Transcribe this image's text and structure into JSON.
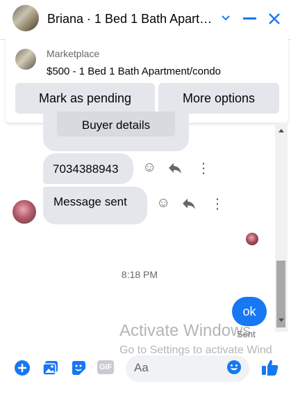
{
  "header": {
    "title": "Briana · 1 Bed 1 Bath Apart…",
    "icons": [
      "chevron-down-icon",
      "minimize-icon",
      "close-icon"
    ]
  },
  "marketplace": {
    "label": "Marketplace",
    "listing": "$500 - 1 Bed 1 Bath Apartment/condo",
    "buttons": {
      "mark_pending": "Mark as pending",
      "more_options": "More options"
    }
  },
  "chat": {
    "buyer_details": "Buyer details",
    "messages": [
      {
        "text": "7034388943"
      },
      {
        "text": "Message sent"
      }
    ],
    "timestamp": "8:18 PM",
    "outgoing": "ok",
    "status": "Sent"
  },
  "watermark": {
    "line1": "Activate Windows",
    "line2": "Go to Settings to activate Wind"
  },
  "composer": {
    "placeholder": "Aa",
    "gif_label": "GIF"
  },
  "colors": {
    "accent": "#1877f2",
    "bubble": "#e4e6eb"
  }
}
